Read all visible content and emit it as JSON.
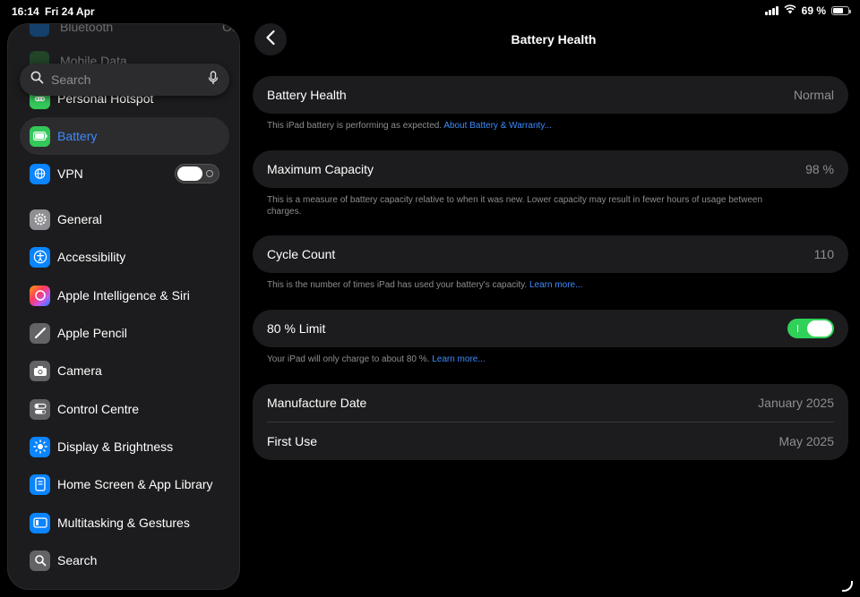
{
  "status_bar": {
    "time": "16:14",
    "date": "Fri 24 Apr",
    "battery": "69 %"
  },
  "sidebar": {
    "faded_items": [
      {
        "label": "Bluetooth",
        "value": "On"
      },
      {
        "label": "Mobile Data"
      }
    ],
    "search": {
      "placeholder": "Search"
    },
    "items": [
      {
        "label": "Personal Hotspot",
        "icon": "hotspot-icon",
        "color": "#34c759"
      },
      {
        "label": "Battery",
        "icon": "battery-icon",
        "color": "#34c759",
        "selected": true
      },
      {
        "label": "VPN",
        "icon": "globe-icon",
        "color": "#0a84ff"
      },
      {
        "label": "General",
        "icon": "gear-icon",
        "color": "#8e8e93"
      },
      {
        "label": "Accessibility",
        "icon": "accessibility-icon",
        "color": "#0a84ff"
      },
      {
        "label": "Apple Intelligence & Siri",
        "icon": "siri-icon",
        "color": "#bf5af2"
      },
      {
        "label": "Apple Pencil",
        "icon": "pencil-icon",
        "color": "#636366"
      },
      {
        "label": "Camera",
        "icon": "camera-icon",
        "color": "#636366"
      },
      {
        "label": "Control Centre",
        "icon": "toggles-icon",
        "color": "#636366"
      },
      {
        "label": "Display & Brightness",
        "icon": "sun-icon",
        "color": "#0a84ff"
      },
      {
        "label": "Home Screen & App Library",
        "icon": "home-screen-icon",
        "color": "#0a84ff"
      },
      {
        "label": "Multitasking & Gestures",
        "icon": "multitasking-icon",
        "color": "#0a84ff"
      },
      {
        "label": "Search",
        "icon": "search-icon",
        "color": "#636366"
      }
    ]
  },
  "main": {
    "title": "Battery Health",
    "battery_health": {
      "label": "Battery Health",
      "value": "Normal",
      "footer_text": "This iPad battery is performing as expected.",
      "footer_link": "About Battery & Warranty..."
    },
    "maximum_capacity": {
      "label": "Maximum Capacity",
      "value": "98 %",
      "footer_text": "This is a measure of battery capacity relative to when it was new. Lower capacity may result in fewer hours of usage between charges."
    },
    "cycle_count": {
      "label": "Cycle Count",
      "value": "110",
      "footer_text": "This is the number of times iPad has used your battery's capacity.",
      "footer_link": "Learn more..."
    },
    "limit": {
      "label": "80 % Limit",
      "footer_text": "Your iPad will only charge to about 80 %.",
      "footer_link": "Learn more..."
    },
    "dates": {
      "manufacture_label": "Manufacture Date",
      "manufacture_value": "January 2025",
      "first_use_label": "First Use",
      "first_use_value": "May 2025"
    }
  }
}
